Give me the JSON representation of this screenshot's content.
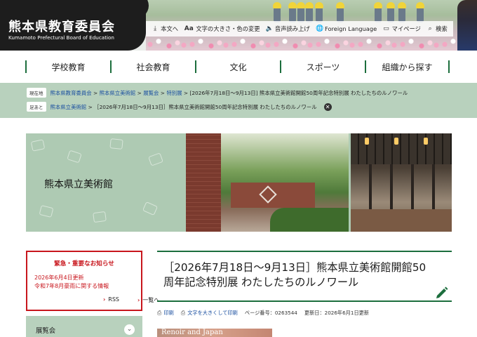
{
  "header": {
    "logo_title": "熊本県教育委員会",
    "logo_subtitle": "Kumamoto Prefectural Board of Education",
    "utility": [
      {
        "label": "本文へ",
        "icon": "arrow-down-icon",
        "glyph": "⤓"
      },
      {
        "label": "文字の大きさ・色の変更",
        "icon": "text-size-icon",
        "glyph": "Aa"
      },
      {
        "label": "音声読み上げ",
        "icon": "speaker-icon",
        "glyph": "🔈"
      },
      {
        "label": "Foreign Language",
        "icon": "globe-icon",
        "glyph": "🌐"
      },
      {
        "label": "マイページ",
        "icon": "folder-icon",
        "glyph": "▭"
      },
      {
        "label": "検索",
        "icon": "search-icon",
        "glyph": "⌕"
      }
    ]
  },
  "nav": [
    "学校教育",
    "社会教育",
    "文化",
    "スポーツ",
    "組織から探す"
  ],
  "breadcrumb": {
    "current_tag": "現在地",
    "current_links": [
      "熊本県教育委員会",
      "熊本県立美術館",
      "展覧会",
      "特別展"
    ],
    "current_page": "[2026年7月18日～9月13日] 熊本県立美術館開館50周年記念特別展 わたしたちのルノワール",
    "history_tag": "足あと",
    "history_link": "熊本県立美術館",
    "history_page": "［2026年7月18日～9月13日］熊本県立美術館開館50周年記念特別展 わたしたちのルノワール",
    "separator": ">"
  },
  "hero": {
    "title": "熊本県立美術館"
  },
  "sidebar": {
    "emergency_title": "緊急・重要なお知らせ",
    "emergency_date": "2026年6月4日更新",
    "emergency_link": "令和7年8月豪雨に関する情報",
    "rss_label": "RSS",
    "list_label": "一覧へ",
    "category_label": "展覧会",
    "category_toggle": "⌄"
  },
  "article": {
    "title": "［2026年7月18日～9月13日］熊本県立美術館開館50周年記念特別展 わたしたちのルノワール",
    "print_label": "印刷",
    "large_print_label": "文字を大きくして印刷",
    "page_number": "ページ番号：0263544",
    "updated": "更新日：2026年6月1日更新",
    "image_caption": "Renoir and Japan"
  },
  "colors": {
    "brand_green": "#1c6e3d",
    "mint": "#b8d1bd",
    "alert_red": "#c8161d",
    "link_blue": "#1a4fa0"
  }
}
